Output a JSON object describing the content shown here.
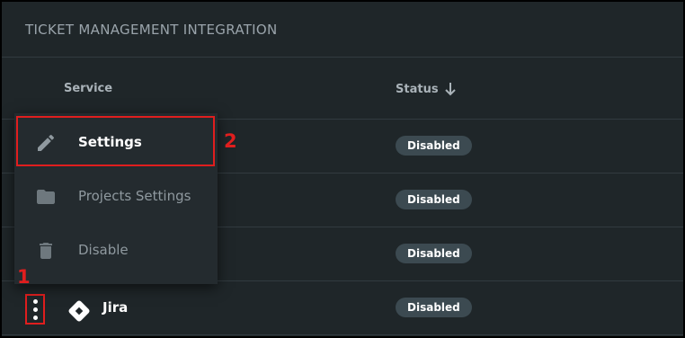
{
  "panel": {
    "title": "TICKET MANAGEMENT INTEGRATION"
  },
  "table": {
    "columns": {
      "service": "Service",
      "status": "Status"
    },
    "sort_direction": "descending",
    "rows": [
      {
        "service": "",
        "status": "Disabled"
      },
      {
        "service": "",
        "status": "Disabled"
      },
      {
        "service": "",
        "status": "Disabled"
      },
      {
        "service": "Jira",
        "status": "Disabled"
      }
    ]
  },
  "menu": {
    "items": [
      {
        "label": "Settings",
        "icon": "pencil-icon"
      },
      {
        "label": "Projects Settings",
        "icon": "folder-icon"
      },
      {
        "label": "Disable",
        "icon": "trash-icon"
      }
    ]
  },
  "annotations": {
    "step1": "1",
    "step2": "2"
  },
  "colors": {
    "annotation": "#e01e1e",
    "badge_bg": "#3c4a51",
    "panel_bg": "#1f2629"
  }
}
